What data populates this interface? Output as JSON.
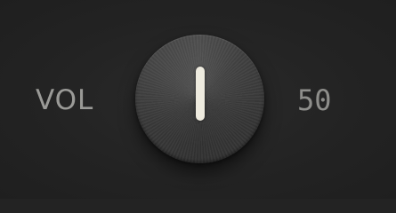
{
  "control": {
    "label": "VOL",
    "value_text": "50",
    "value": 50,
    "min": 0,
    "max": 100
  },
  "colors": {
    "background": "#232323",
    "label": "#9a9a97",
    "pointer": "#eeebdf",
    "knob": "#3c3c3c"
  },
  "icons": {
    "knob": "rotary-knob",
    "indicator": "knob-pointer"
  }
}
